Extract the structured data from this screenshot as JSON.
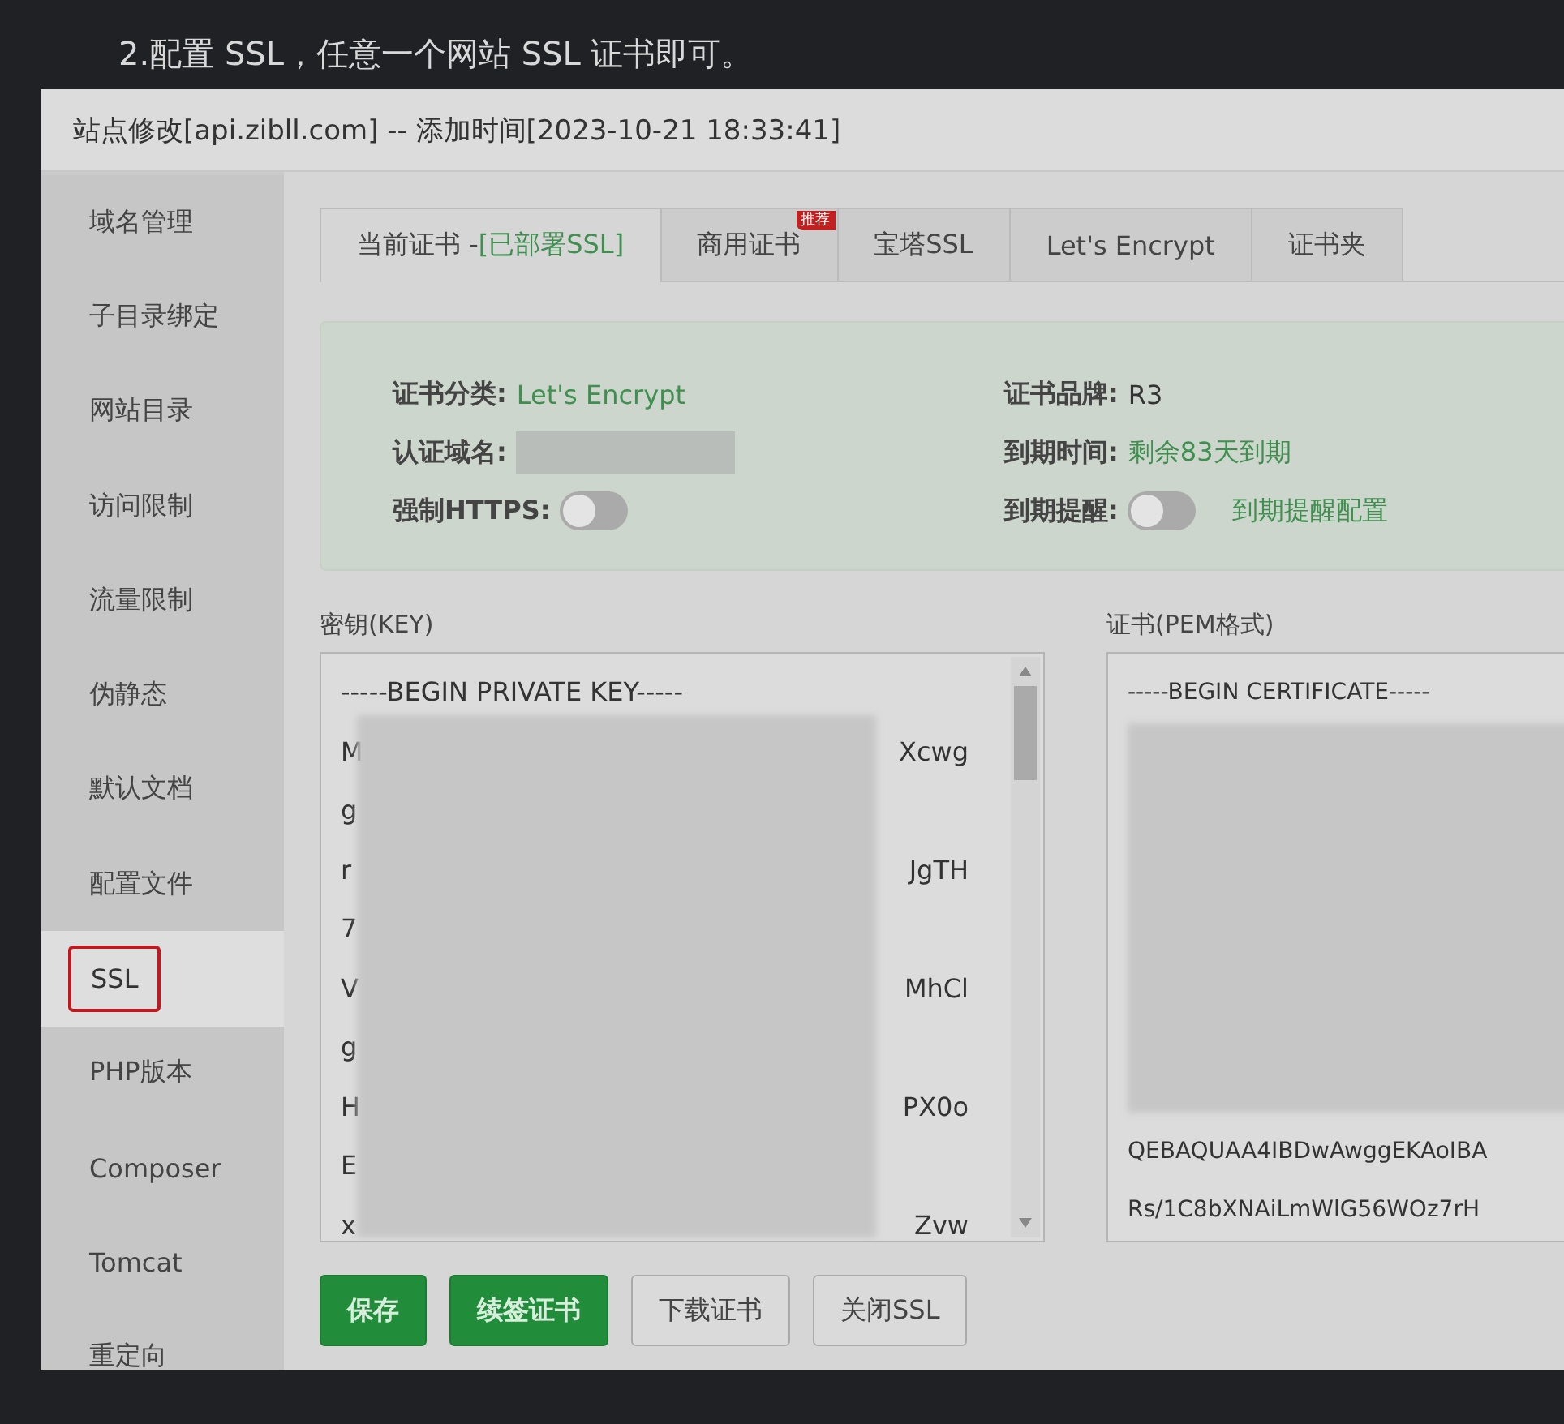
{
  "heading": "2.配置 SSL，任意一个网站 SSL 证书即可。",
  "window": {
    "title": "站点修改[api.zibll.com] -- 添加时间[2023-10-21 18:33:41]"
  },
  "sidebar": {
    "items": [
      {
        "label": "域名管理",
        "selected": false,
        "highlighted": false
      },
      {
        "label": "子目录绑定",
        "selected": false,
        "highlighted": false
      },
      {
        "label": "网站目录",
        "selected": false,
        "highlighted": false
      },
      {
        "label": "访问限制",
        "selected": false,
        "highlighted": false
      },
      {
        "label": "流量限制",
        "selected": false,
        "highlighted": false
      },
      {
        "label": "伪静态",
        "selected": false,
        "highlighted": false
      },
      {
        "label": "默认文档",
        "selected": false,
        "highlighted": false
      },
      {
        "label": "配置文件",
        "selected": false,
        "highlighted": false
      },
      {
        "label": "SSL",
        "selected": true,
        "highlighted": true
      },
      {
        "label": "PHP版本",
        "selected": false,
        "highlighted": false
      },
      {
        "label": "Composer",
        "selected": false,
        "highlighted": false
      },
      {
        "label": "Tomcat",
        "selected": false,
        "highlighted": false
      },
      {
        "label": "重定向",
        "selected": false,
        "highlighted": false
      }
    ]
  },
  "tabs": [
    {
      "label": "当前证书 - ",
      "status": "[已部署SSL]",
      "selected": true
    },
    {
      "label": "商用证书",
      "ribbon": "推荐",
      "selected": false
    },
    {
      "label": "宝塔SSL",
      "selected": false
    },
    {
      "label": "Let's Encrypt",
      "selected": false
    },
    {
      "label": "证书夹",
      "selected": false
    }
  ],
  "info": {
    "left": [
      {
        "kind": "text",
        "label": "证书分类:",
        "value": "Let's Encrypt"
      },
      {
        "kind": "redacted",
        "label": "认证域名:"
      },
      {
        "kind": "toggle",
        "label": "强制HTTPS:",
        "on": false
      }
    ],
    "right": [
      {
        "kind": "text",
        "label": "证书品牌:",
        "value": "R3",
        "green": false
      },
      {
        "kind": "text",
        "label": "到期时间:",
        "value": "剩余83天到期",
        "green": true
      },
      {
        "kind": "toggle",
        "label": "到期提醒:",
        "on": false,
        "link": "到期提醒配置"
      }
    ]
  },
  "key": {
    "label": "密钥(KEY)",
    "first_line": "-----BEGIN PRIVATE KEY-----",
    "lines": [
      {
        "start": "M",
        "end": "Xcwg"
      },
      {
        "start": "g"
      },
      {
        "start": "r",
        "end": "JgTH"
      },
      {
        "start": "7"
      },
      {
        "start": "V",
        "end": "MhCl"
      },
      {
        "start": "g"
      },
      {
        "start": "H",
        "end": "PX0o"
      },
      {
        "start": "E"
      },
      {
        "start": "x",
        "end": "Zvw"
      }
    ]
  },
  "cert": {
    "label": "证书(PEM格式)",
    "first_line": "-----BEGIN CERTIFICATE-----",
    "lines": [
      "QEBAQUAA4IBDwAwggEKAoIBA",
      "Rs/1C8bXNAiLmWlG56WOz7rH"
    ]
  },
  "buttons": [
    {
      "label": "保存",
      "kind": "primary"
    },
    {
      "label": "续签证书",
      "kind": "primary"
    },
    {
      "label": "下载证书",
      "kind": "default"
    },
    {
      "label": "关闭SSL",
      "kind": "default"
    }
  ]
}
